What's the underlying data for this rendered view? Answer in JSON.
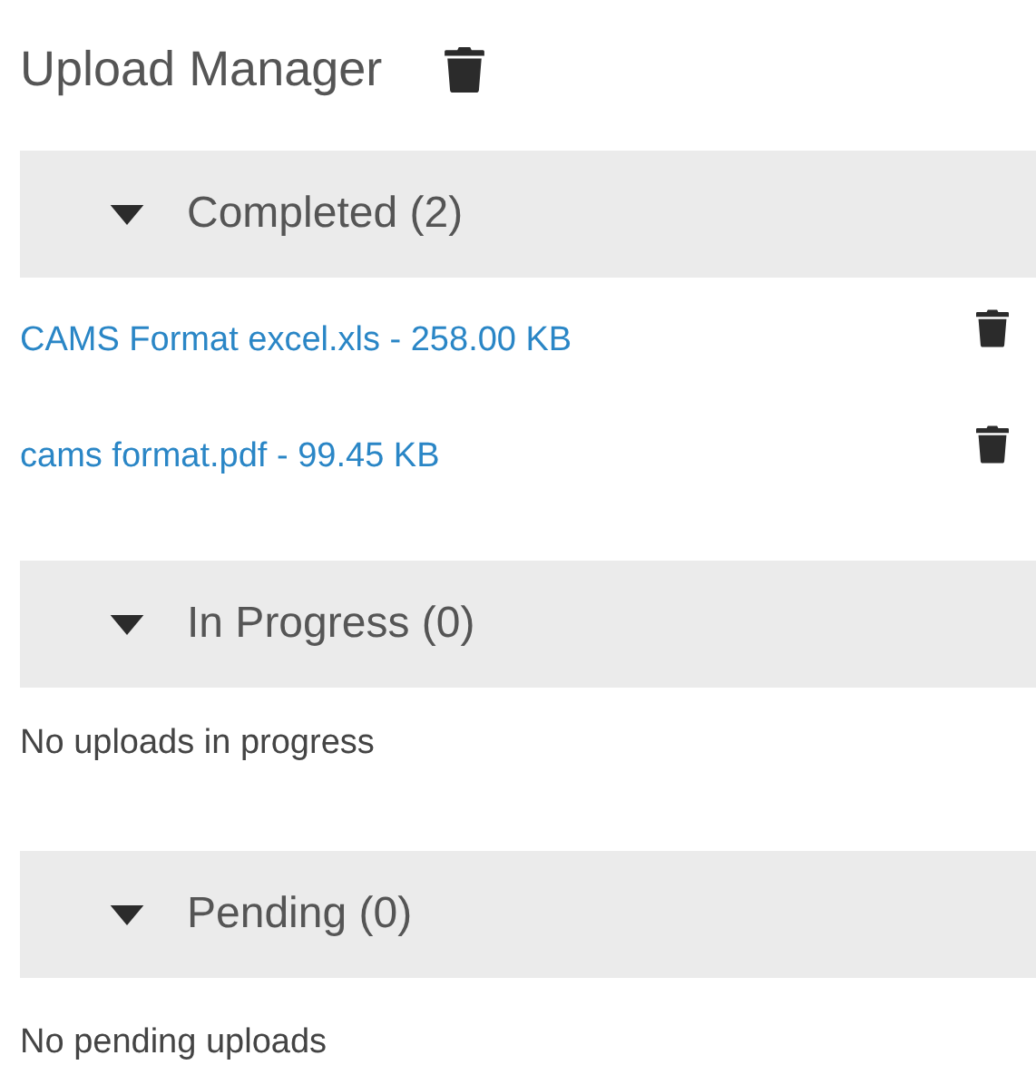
{
  "title": "Upload Manager",
  "sections": [
    {
      "label": "Completed (2)",
      "expanded": true,
      "files": [
        {
          "name": "CAMS Format excel.xls - 258.00 KB"
        },
        {
          "name": "cams format.pdf - 99.45 KB"
        }
      ]
    },
    {
      "label": "In Progress (0)",
      "expanded": true,
      "empty_text": "No uploads in progress"
    },
    {
      "label": "Pending (0)",
      "expanded": true,
      "empty_text": "No pending uploads"
    }
  ]
}
